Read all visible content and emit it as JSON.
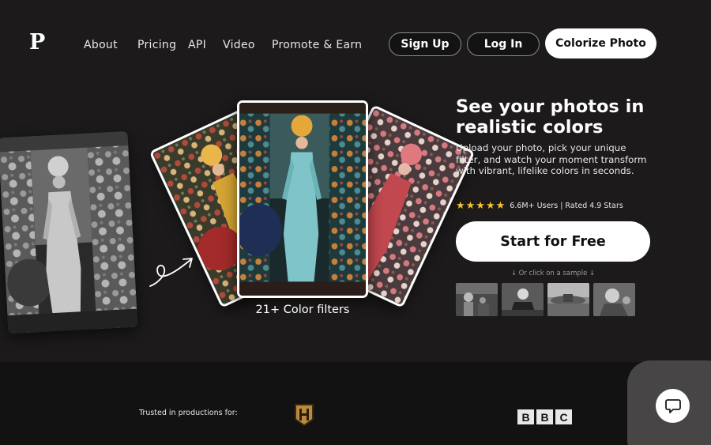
{
  "brand": {
    "logo": "P"
  },
  "nav": {
    "links": [
      "About",
      "Pricing",
      "API",
      "Video",
      "Promote & Earn"
    ],
    "sign_up": "Sign Up",
    "log_in": "Log In",
    "colorize": "Colorize Photo"
  },
  "hero": {
    "headline": "See your photos in realistic colors",
    "subtext": "Upload your photo, pick your unique filter, and watch your moment transform with vibrant, lifelike colors in seconds.",
    "stars": "★★★★★",
    "rating": "6.6M+ Users | Rated 4.9 Stars",
    "cta": "Start for Free",
    "sample_hint": "↓ Or click on a sample ↓",
    "filters_caption": "21+ Color filters"
  },
  "trusted": {
    "label": "Trusted in productions for:",
    "logos": [
      "History",
      "BBC"
    ],
    "bbc_letters": [
      "B",
      "B",
      "C"
    ]
  },
  "icons": {
    "arrow": "curly-arrow-icon",
    "chat": "chat-bubble-icon",
    "star": "star-icon"
  },
  "colors": {
    "background": "#1c1a1b",
    "footer_band": "#131213",
    "star": "#f4c430",
    "button_light": "#ffffff",
    "chat_bg": "#474546"
  }
}
